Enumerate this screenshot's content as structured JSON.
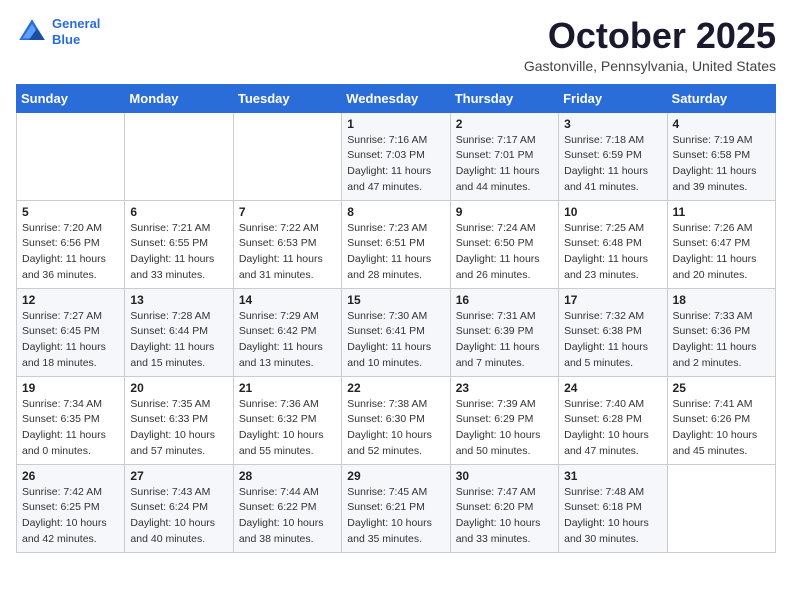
{
  "logo": {
    "line1": "General",
    "line2": "Blue"
  },
  "title": "October 2025",
  "location": "Gastonville, Pennsylvania, United States",
  "days_of_week": [
    "Sunday",
    "Monday",
    "Tuesday",
    "Wednesday",
    "Thursday",
    "Friday",
    "Saturday"
  ],
  "weeks": [
    [
      {
        "day": "",
        "info": ""
      },
      {
        "day": "",
        "info": ""
      },
      {
        "day": "",
        "info": ""
      },
      {
        "day": "1",
        "info": "Sunrise: 7:16 AM\nSunset: 7:03 PM\nDaylight: 11 hours\nand 47 minutes."
      },
      {
        "day": "2",
        "info": "Sunrise: 7:17 AM\nSunset: 7:01 PM\nDaylight: 11 hours\nand 44 minutes."
      },
      {
        "day": "3",
        "info": "Sunrise: 7:18 AM\nSunset: 6:59 PM\nDaylight: 11 hours\nand 41 minutes."
      },
      {
        "day": "4",
        "info": "Sunrise: 7:19 AM\nSunset: 6:58 PM\nDaylight: 11 hours\nand 39 minutes."
      }
    ],
    [
      {
        "day": "5",
        "info": "Sunrise: 7:20 AM\nSunset: 6:56 PM\nDaylight: 11 hours\nand 36 minutes."
      },
      {
        "day": "6",
        "info": "Sunrise: 7:21 AM\nSunset: 6:55 PM\nDaylight: 11 hours\nand 33 minutes."
      },
      {
        "day": "7",
        "info": "Sunrise: 7:22 AM\nSunset: 6:53 PM\nDaylight: 11 hours\nand 31 minutes."
      },
      {
        "day": "8",
        "info": "Sunrise: 7:23 AM\nSunset: 6:51 PM\nDaylight: 11 hours\nand 28 minutes."
      },
      {
        "day": "9",
        "info": "Sunrise: 7:24 AM\nSunset: 6:50 PM\nDaylight: 11 hours\nand 26 minutes."
      },
      {
        "day": "10",
        "info": "Sunrise: 7:25 AM\nSunset: 6:48 PM\nDaylight: 11 hours\nand 23 minutes."
      },
      {
        "day": "11",
        "info": "Sunrise: 7:26 AM\nSunset: 6:47 PM\nDaylight: 11 hours\nand 20 minutes."
      }
    ],
    [
      {
        "day": "12",
        "info": "Sunrise: 7:27 AM\nSunset: 6:45 PM\nDaylight: 11 hours\nand 18 minutes."
      },
      {
        "day": "13",
        "info": "Sunrise: 7:28 AM\nSunset: 6:44 PM\nDaylight: 11 hours\nand 15 minutes."
      },
      {
        "day": "14",
        "info": "Sunrise: 7:29 AM\nSunset: 6:42 PM\nDaylight: 11 hours\nand 13 minutes."
      },
      {
        "day": "15",
        "info": "Sunrise: 7:30 AM\nSunset: 6:41 PM\nDaylight: 11 hours\nand 10 minutes."
      },
      {
        "day": "16",
        "info": "Sunrise: 7:31 AM\nSunset: 6:39 PM\nDaylight: 11 hours\nand 7 minutes."
      },
      {
        "day": "17",
        "info": "Sunrise: 7:32 AM\nSunset: 6:38 PM\nDaylight: 11 hours\nand 5 minutes."
      },
      {
        "day": "18",
        "info": "Sunrise: 7:33 AM\nSunset: 6:36 PM\nDaylight: 11 hours\nand 2 minutes."
      }
    ],
    [
      {
        "day": "19",
        "info": "Sunrise: 7:34 AM\nSunset: 6:35 PM\nDaylight: 11 hours\nand 0 minutes."
      },
      {
        "day": "20",
        "info": "Sunrise: 7:35 AM\nSunset: 6:33 PM\nDaylight: 10 hours\nand 57 minutes."
      },
      {
        "day": "21",
        "info": "Sunrise: 7:36 AM\nSunset: 6:32 PM\nDaylight: 10 hours\nand 55 minutes."
      },
      {
        "day": "22",
        "info": "Sunrise: 7:38 AM\nSunset: 6:30 PM\nDaylight: 10 hours\nand 52 minutes."
      },
      {
        "day": "23",
        "info": "Sunrise: 7:39 AM\nSunset: 6:29 PM\nDaylight: 10 hours\nand 50 minutes."
      },
      {
        "day": "24",
        "info": "Sunrise: 7:40 AM\nSunset: 6:28 PM\nDaylight: 10 hours\nand 47 minutes."
      },
      {
        "day": "25",
        "info": "Sunrise: 7:41 AM\nSunset: 6:26 PM\nDaylight: 10 hours\nand 45 minutes."
      }
    ],
    [
      {
        "day": "26",
        "info": "Sunrise: 7:42 AM\nSunset: 6:25 PM\nDaylight: 10 hours\nand 42 minutes."
      },
      {
        "day": "27",
        "info": "Sunrise: 7:43 AM\nSunset: 6:24 PM\nDaylight: 10 hours\nand 40 minutes."
      },
      {
        "day": "28",
        "info": "Sunrise: 7:44 AM\nSunset: 6:22 PM\nDaylight: 10 hours\nand 38 minutes."
      },
      {
        "day": "29",
        "info": "Sunrise: 7:45 AM\nSunset: 6:21 PM\nDaylight: 10 hours\nand 35 minutes."
      },
      {
        "day": "30",
        "info": "Sunrise: 7:47 AM\nSunset: 6:20 PM\nDaylight: 10 hours\nand 33 minutes."
      },
      {
        "day": "31",
        "info": "Sunrise: 7:48 AM\nSunset: 6:18 PM\nDaylight: 10 hours\nand 30 minutes."
      },
      {
        "day": "",
        "info": ""
      }
    ]
  ]
}
